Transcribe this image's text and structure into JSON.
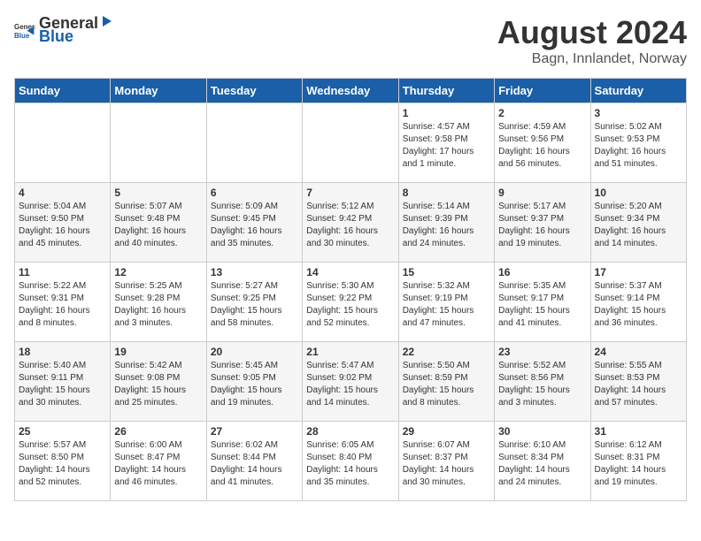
{
  "header": {
    "logo_general": "General",
    "logo_blue": "Blue",
    "month_year": "August 2024",
    "location": "Bagn, Innlandet, Norway"
  },
  "weekdays": [
    "Sunday",
    "Monday",
    "Tuesday",
    "Wednesday",
    "Thursday",
    "Friday",
    "Saturday"
  ],
  "weeks": [
    [
      {
        "day": "",
        "info": ""
      },
      {
        "day": "",
        "info": ""
      },
      {
        "day": "",
        "info": ""
      },
      {
        "day": "",
        "info": ""
      },
      {
        "day": "1",
        "info": "Sunrise: 4:57 AM\nSunset: 9:58 PM\nDaylight: 17 hours\nand 1 minute."
      },
      {
        "day": "2",
        "info": "Sunrise: 4:59 AM\nSunset: 9:56 PM\nDaylight: 16 hours\nand 56 minutes."
      },
      {
        "day": "3",
        "info": "Sunrise: 5:02 AM\nSunset: 9:53 PM\nDaylight: 16 hours\nand 51 minutes."
      }
    ],
    [
      {
        "day": "4",
        "info": "Sunrise: 5:04 AM\nSunset: 9:50 PM\nDaylight: 16 hours\nand 45 minutes."
      },
      {
        "day": "5",
        "info": "Sunrise: 5:07 AM\nSunset: 9:48 PM\nDaylight: 16 hours\nand 40 minutes."
      },
      {
        "day": "6",
        "info": "Sunrise: 5:09 AM\nSunset: 9:45 PM\nDaylight: 16 hours\nand 35 minutes."
      },
      {
        "day": "7",
        "info": "Sunrise: 5:12 AM\nSunset: 9:42 PM\nDaylight: 16 hours\nand 30 minutes."
      },
      {
        "day": "8",
        "info": "Sunrise: 5:14 AM\nSunset: 9:39 PM\nDaylight: 16 hours\nand 24 minutes."
      },
      {
        "day": "9",
        "info": "Sunrise: 5:17 AM\nSunset: 9:37 PM\nDaylight: 16 hours\nand 19 minutes."
      },
      {
        "day": "10",
        "info": "Sunrise: 5:20 AM\nSunset: 9:34 PM\nDaylight: 16 hours\nand 14 minutes."
      }
    ],
    [
      {
        "day": "11",
        "info": "Sunrise: 5:22 AM\nSunset: 9:31 PM\nDaylight: 16 hours\nand 8 minutes."
      },
      {
        "day": "12",
        "info": "Sunrise: 5:25 AM\nSunset: 9:28 PM\nDaylight: 16 hours\nand 3 minutes."
      },
      {
        "day": "13",
        "info": "Sunrise: 5:27 AM\nSunset: 9:25 PM\nDaylight: 15 hours\nand 58 minutes."
      },
      {
        "day": "14",
        "info": "Sunrise: 5:30 AM\nSunset: 9:22 PM\nDaylight: 15 hours\nand 52 minutes."
      },
      {
        "day": "15",
        "info": "Sunrise: 5:32 AM\nSunset: 9:19 PM\nDaylight: 15 hours\nand 47 minutes."
      },
      {
        "day": "16",
        "info": "Sunrise: 5:35 AM\nSunset: 9:17 PM\nDaylight: 15 hours\nand 41 minutes."
      },
      {
        "day": "17",
        "info": "Sunrise: 5:37 AM\nSunset: 9:14 PM\nDaylight: 15 hours\nand 36 minutes."
      }
    ],
    [
      {
        "day": "18",
        "info": "Sunrise: 5:40 AM\nSunset: 9:11 PM\nDaylight: 15 hours\nand 30 minutes."
      },
      {
        "day": "19",
        "info": "Sunrise: 5:42 AM\nSunset: 9:08 PM\nDaylight: 15 hours\nand 25 minutes."
      },
      {
        "day": "20",
        "info": "Sunrise: 5:45 AM\nSunset: 9:05 PM\nDaylight: 15 hours\nand 19 minutes."
      },
      {
        "day": "21",
        "info": "Sunrise: 5:47 AM\nSunset: 9:02 PM\nDaylight: 15 hours\nand 14 minutes."
      },
      {
        "day": "22",
        "info": "Sunrise: 5:50 AM\nSunset: 8:59 PM\nDaylight: 15 hours\nand 8 minutes."
      },
      {
        "day": "23",
        "info": "Sunrise: 5:52 AM\nSunset: 8:56 PM\nDaylight: 15 hours\nand 3 minutes."
      },
      {
        "day": "24",
        "info": "Sunrise: 5:55 AM\nSunset: 8:53 PM\nDaylight: 14 hours\nand 57 minutes."
      }
    ],
    [
      {
        "day": "25",
        "info": "Sunrise: 5:57 AM\nSunset: 8:50 PM\nDaylight: 14 hours\nand 52 minutes."
      },
      {
        "day": "26",
        "info": "Sunrise: 6:00 AM\nSunset: 8:47 PM\nDaylight: 14 hours\nand 46 minutes."
      },
      {
        "day": "27",
        "info": "Sunrise: 6:02 AM\nSunset: 8:44 PM\nDaylight: 14 hours\nand 41 minutes."
      },
      {
        "day": "28",
        "info": "Sunrise: 6:05 AM\nSunset: 8:40 PM\nDaylight: 14 hours\nand 35 minutes."
      },
      {
        "day": "29",
        "info": "Sunrise: 6:07 AM\nSunset: 8:37 PM\nDaylight: 14 hours\nand 30 minutes."
      },
      {
        "day": "30",
        "info": "Sunrise: 6:10 AM\nSunset: 8:34 PM\nDaylight: 14 hours\nand 24 minutes."
      },
      {
        "day": "31",
        "info": "Sunrise: 6:12 AM\nSunset: 8:31 PM\nDaylight: 14 hours\nand 19 minutes."
      }
    ]
  ]
}
